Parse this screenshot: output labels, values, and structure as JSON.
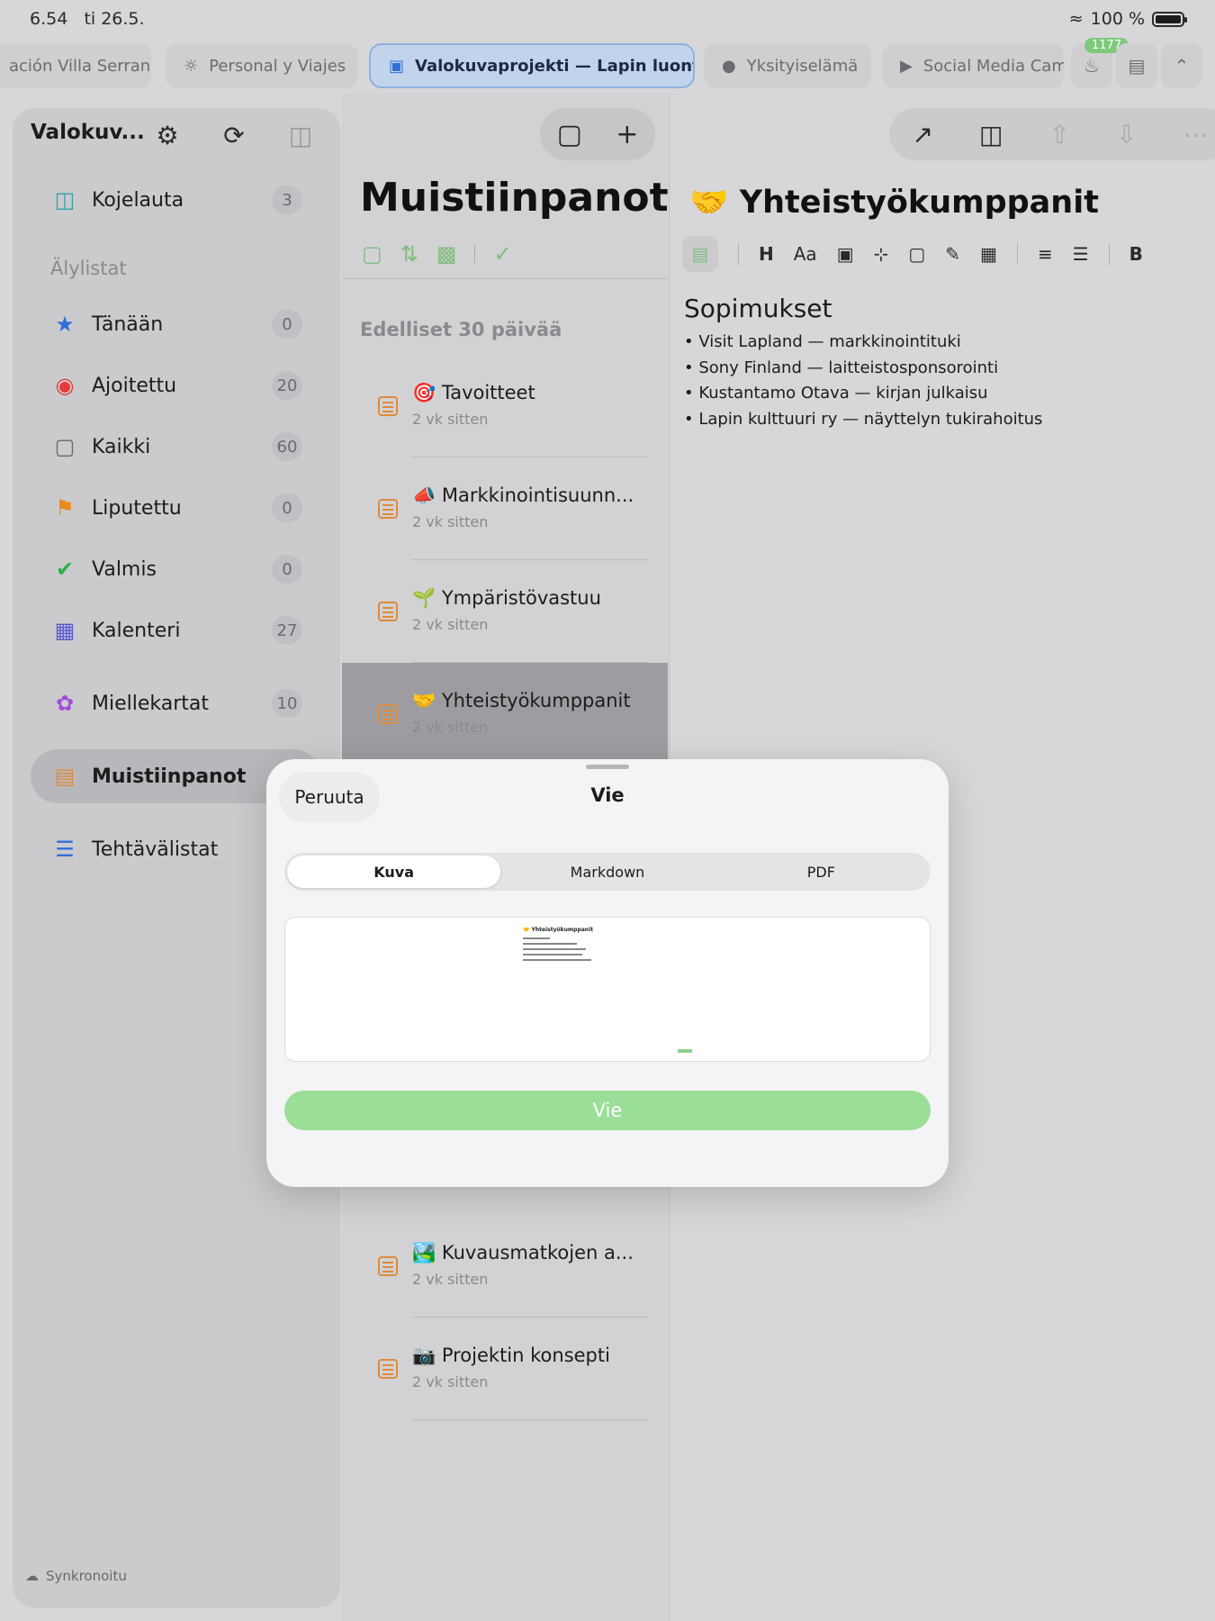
{
  "status": {
    "time": "6.54",
    "date": "ti 26.5.",
    "battery": "100 %"
  },
  "tabs": [
    {
      "label": "ación Villa Serrano"
    },
    {
      "label": "Personal y Viajes",
      "icon": "sun-icon"
    },
    {
      "label": "Valokuvaprojekti — Lapin luonto",
      "icon": "camera-icon",
      "active": true
    },
    {
      "label": "Yksityiselämä",
      "icon": "circle-icon"
    },
    {
      "label": "Social Media Cam",
      "icon": "megaphone-icon"
    }
  ],
  "notif_badge": "1177",
  "sidebar": {
    "title": "Valokuv...",
    "section_label": "Älylistat",
    "dashboard": {
      "label": "Kojelauta",
      "count": "3"
    },
    "items": [
      {
        "label": "Tänään",
        "count": "0"
      },
      {
        "label": "Ajoitettu",
        "count": "20"
      },
      {
        "label": "Kaikki",
        "count": "60"
      },
      {
        "label": "Liputettu",
        "count": "0"
      },
      {
        "label": "Valmis",
        "count": "0"
      },
      {
        "label": "Kalenteri",
        "count": "27"
      }
    ],
    "mindmaps": {
      "label": "Miellekartat",
      "count": "10"
    },
    "notes": {
      "label": "Muistiinpanot"
    },
    "tasks": {
      "label": "Tehtävälistat"
    },
    "sync": "Synkronoitu"
  },
  "notelist": {
    "title": "Muistiinpanot",
    "group": "Edelliset 30 päivää",
    "items": [
      {
        "emoji": "🎯",
        "title": "Tavoitteet",
        "date": "2 vk sitten"
      },
      {
        "emoji": "📣",
        "title": "Markkinointisuunn...",
        "date": "2 vk sitten"
      },
      {
        "emoji": "🌱",
        "title": "Ympäristövastuu",
        "date": "2 vk sitten"
      },
      {
        "emoji": "🤝",
        "title": "Yhteistyökumppanit",
        "date": "2 vk sitten"
      },
      {
        "emoji": "🏞️",
        "title": "Kuvausmatkojen a...",
        "date": "2 vk sitten"
      },
      {
        "emoji": "📷",
        "title": "Projektin konsepti",
        "date": "2 vk sitten"
      }
    ]
  },
  "detail": {
    "title": "🤝 Yhteistyökumppanit",
    "heading": "Sopimukset",
    "format": {
      "h": "H",
      "aa": "Aa",
      "bold": "B"
    },
    "bullets": [
      "Visit Lapland — markkinointituki",
      "Sony Finland — laitteistosponsorointi",
      "Kustantamo Otava — kirjan julkaisu",
      "Lapin kulttuuri ry — näyttelyn tukirahoitus"
    ]
  },
  "sheet": {
    "cancel": "Peruuta",
    "title": "Vie",
    "segments": [
      "Kuva",
      "Markdown",
      "PDF"
    ],
    "preview_title": "🤝 Yhteistyökumppanit",
    "export": "Vie"
  }
}
